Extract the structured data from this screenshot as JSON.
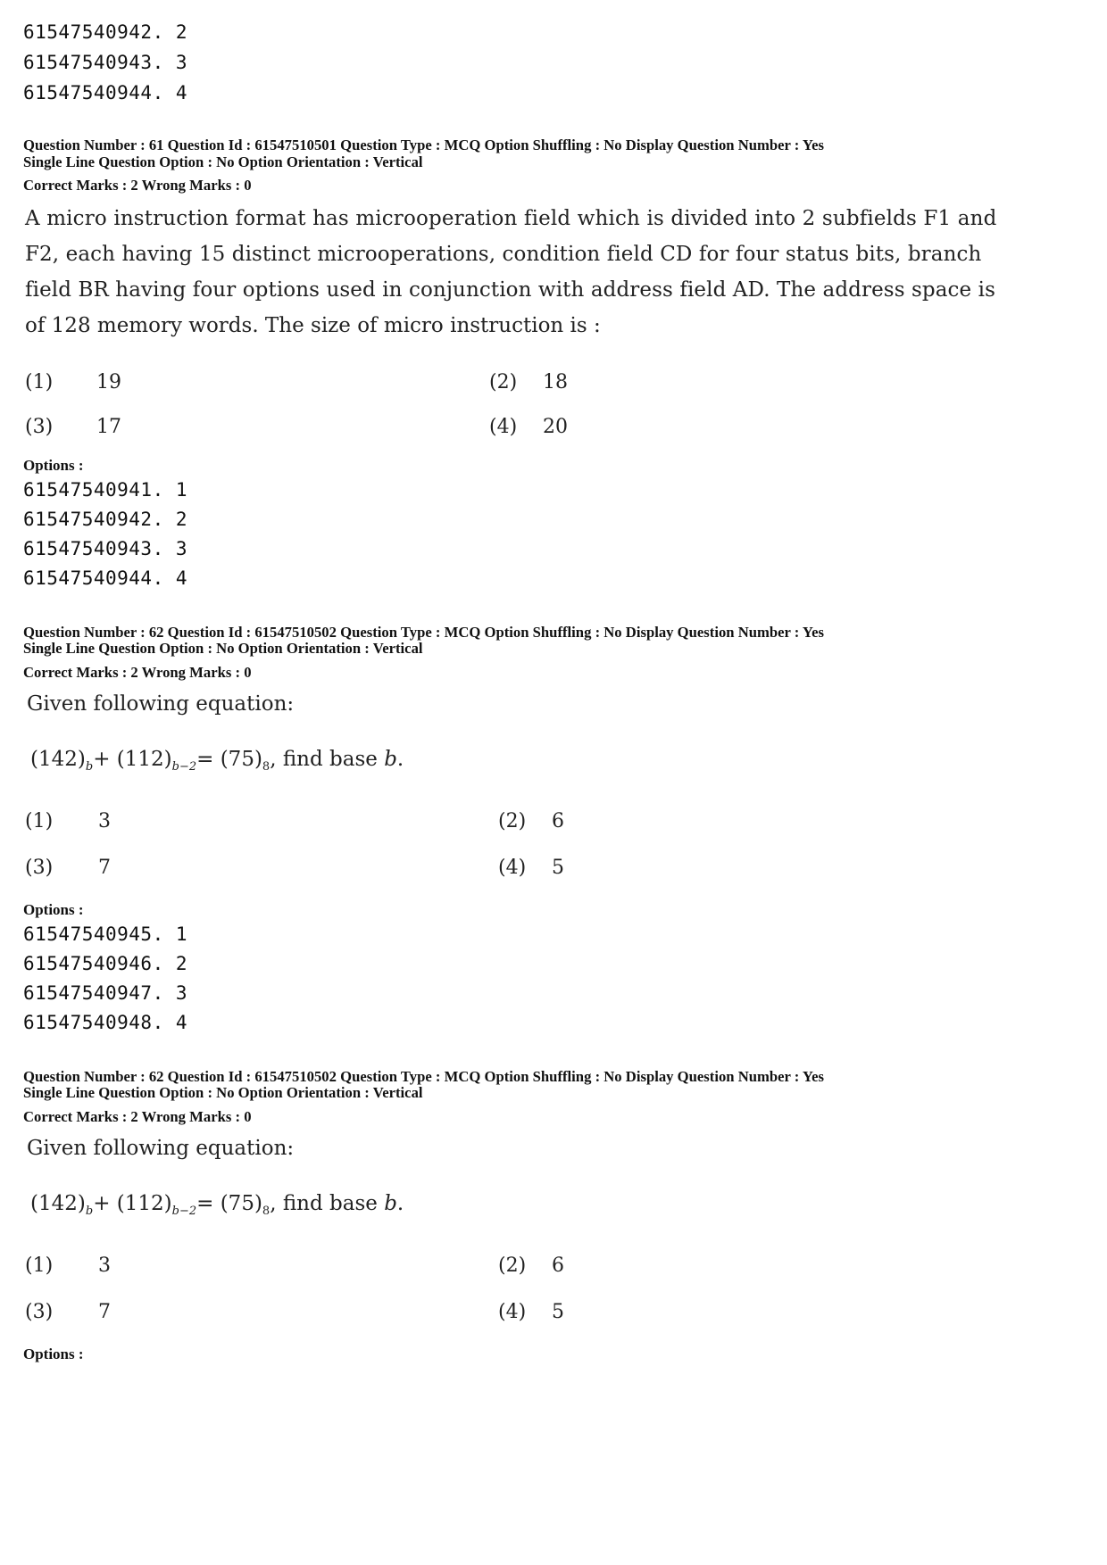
{
  "carryover_options": [
    "61547540942. 2",
    "61547540943. 3",
    "61547540944. 4"
  ],
  "questions": [
    {
      "meta_line1": "Question Number : 61  Question Id : 61547510501  Question Type : MCQ  Option Shuffling : No  Display Question Number : Yes",
      "meta_line2": "Single Line Question Option : No  Option Orientation : Vertical",
      "marks": "Correct Marks : 2  Wrong Marks : 0",
      "text_lines": [
        "A micro instruction format has microoperation field which is divided into 2 subfields F1 and",
        "F2, each having 15 distinct microoperations, condition field CD for four status bits, branch",
        "field BR having four options used in conjunction with address field AD. The address space is",
        "of 128 memory words. The size of micro instruction is :"
      ],
      "answers": [
        {
          "label": "(1)",
          "value": "19"
        },
        {
          "label": "(2)",
          "value": "18"
        },
        {
          "label": "(3)",
          "value": "17"
        },
        {
          "label": "(4)",
          "value": "20"
        }
      ],
      "options_heading": "Options :",
      "option_ids": [
        "61547540941. 1",
        "61547540942. 2",
        "61547540943. 3",
        "61547540944. 4"
      ]
    },
    {
      "meta_line1": "Question Number : 62  Question Id : 61547510502  Question Type : MCQ  Option Shuffling : No  Display Question Number : Yes",
      "meta_line2": "Single Line Question Option : No  Option Orientation : Vertical",
      "marks": "Correct Marks : 2  Wrong Marks : 0",
      "intro": "Given following equation:",
      "equation": {
        "t1": "(142)",
        "s1": "b",
        "t2": "+ (112)",
        "s2": "b−2",
        "t3": "= (75)",
        "s3": "8",
        "t4": ", find base ",
        "var": "b",
        "t5": "."
      },
      "answers": [
        {
          "label": "(1)",
          "value": "3"
        },
        {
          "label": "(2)",
          "value": "6"
        },
        {
          "label": "(3)",
          "value": "7"
        },
        {
          "label": "(4)",
          "value": "5"
        }
      ],
      "options_heading": "Options :",
      "option_ids": [
        "61547540945. 1",
        "61547540946. 2",
        "61547540947. 3",
        "61547540948. 4"
      ]
    },
    {
      "meta_line1": "Question Number : 62  Question Id : 61547510502  Question Type : MCQ  Option Shuffling : No  Display Question Number : Yes",
      "meta_line2": "Single Line Question Option : No  Option Orientation : Vertical",
      "marks": "Correct Marks : 2  Wrong Marks : 0",
      "intro": "Given following equation:",
      "equation": {
        "t1": "(142)",
        "s1": "b",
        "t2": "+ (112)",
        "s2": "b−2",
        "t3": "= (75)",
        "s3": "8",
        "t4": ", find base ",
        "var": "b",
        "t5": "."
      },
      "answers": [
        {
          "label": "(1)",
          "value": "3"
        },
        {
          "label": "(2)",
          "value": "6"
        },
        {
          "label": "(3)",
          "value": "7"
        },
        {
          "label": "(4)",
          "value": "5"
        }
      ],
      "options_heading": "Options :"
    }
  ]
}
